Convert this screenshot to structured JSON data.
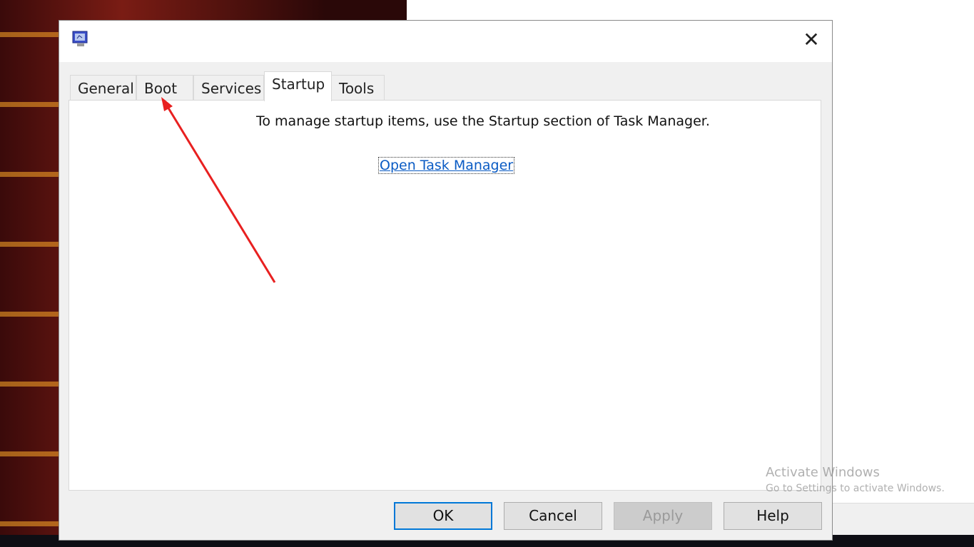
{
  "dialog": {
    "close_icon": "close-icon",
    "tabs": [
      {
        "label": "General"
      },
      {
        "label": "Boot"
      },
      {
        "label": "Services"
      },
      {
        "label": "Startup",
        "active": true
      },
      {
        "label": "Tools"
      }
    ],
    "message": "To manage startup items, use the Startup section of Task Manager.",
    "link": "Open Task Manager",
    "buttons": {
      "ok": "OK",
      "cancel": "Cancel",
      "apply": "Apply",
      "help": "Help"
    }
  },
  "watermark": {
    "title": "Activate Windows",
    "subtitle": "Go to Settings to activate Windows."
  },
  "annotation": {
    "color": "#e82020",
    "target": "Boot tab"
  },
  "colors": {
    "link": "#0a5bc4",
    "focus": "#0078d7"
  }
}
